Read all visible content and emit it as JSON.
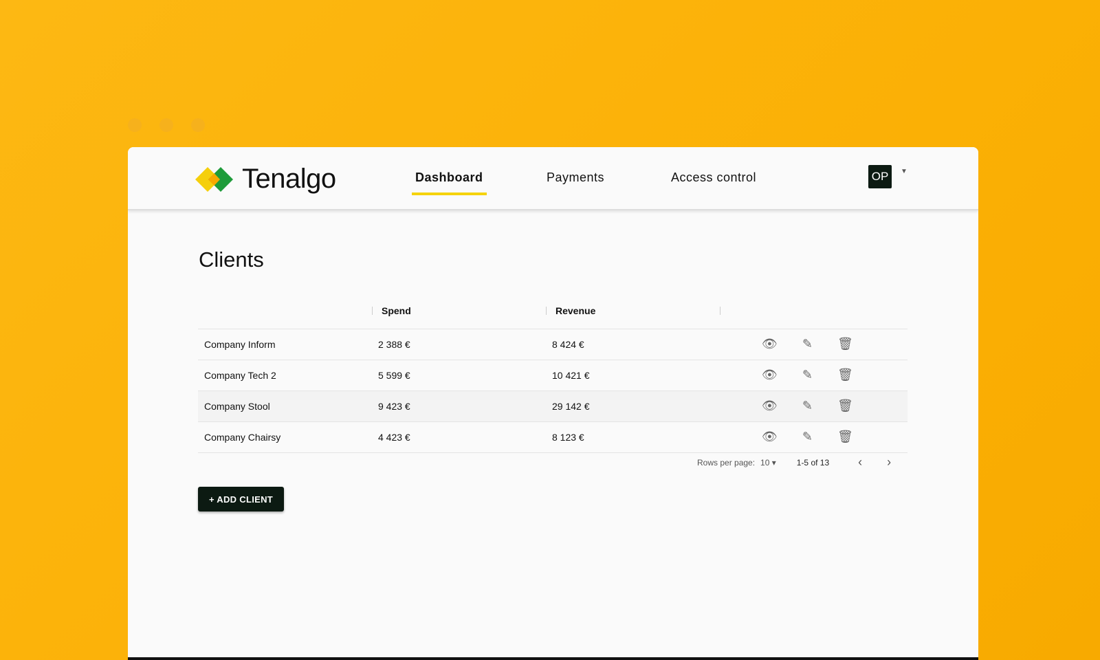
{
  "brand": "Tenalgo",
  "nav": [
    "Dashboard",
    "Payments",
    "Access control"
  ],
  "user": "OP",
  "title": "Clients",
  "columns": [
    "",
    "Spend",
    "Revenue",
    ""
  ],
  "rows": [
    [
      "Company Inform",
      "2 388 €",
      "8 424 €"
    ],
    [
      "Company Tech 2",
      "5 599 €",
      "10 421 €"
    ],
    [
      "Company Stool",
      "9 423 €",
      "29 142 €"
    ],
    [
      "Company Chairsy",
      "4 423 €",
      "8 123 €"
    ]
  ],
  "pagination": {
    "rows_label": "Rows per page:",
    "rows_value": "10",
    "range": "1-5 of 13"
  },
  "add_button": "+ ADD CLIENT"
}
